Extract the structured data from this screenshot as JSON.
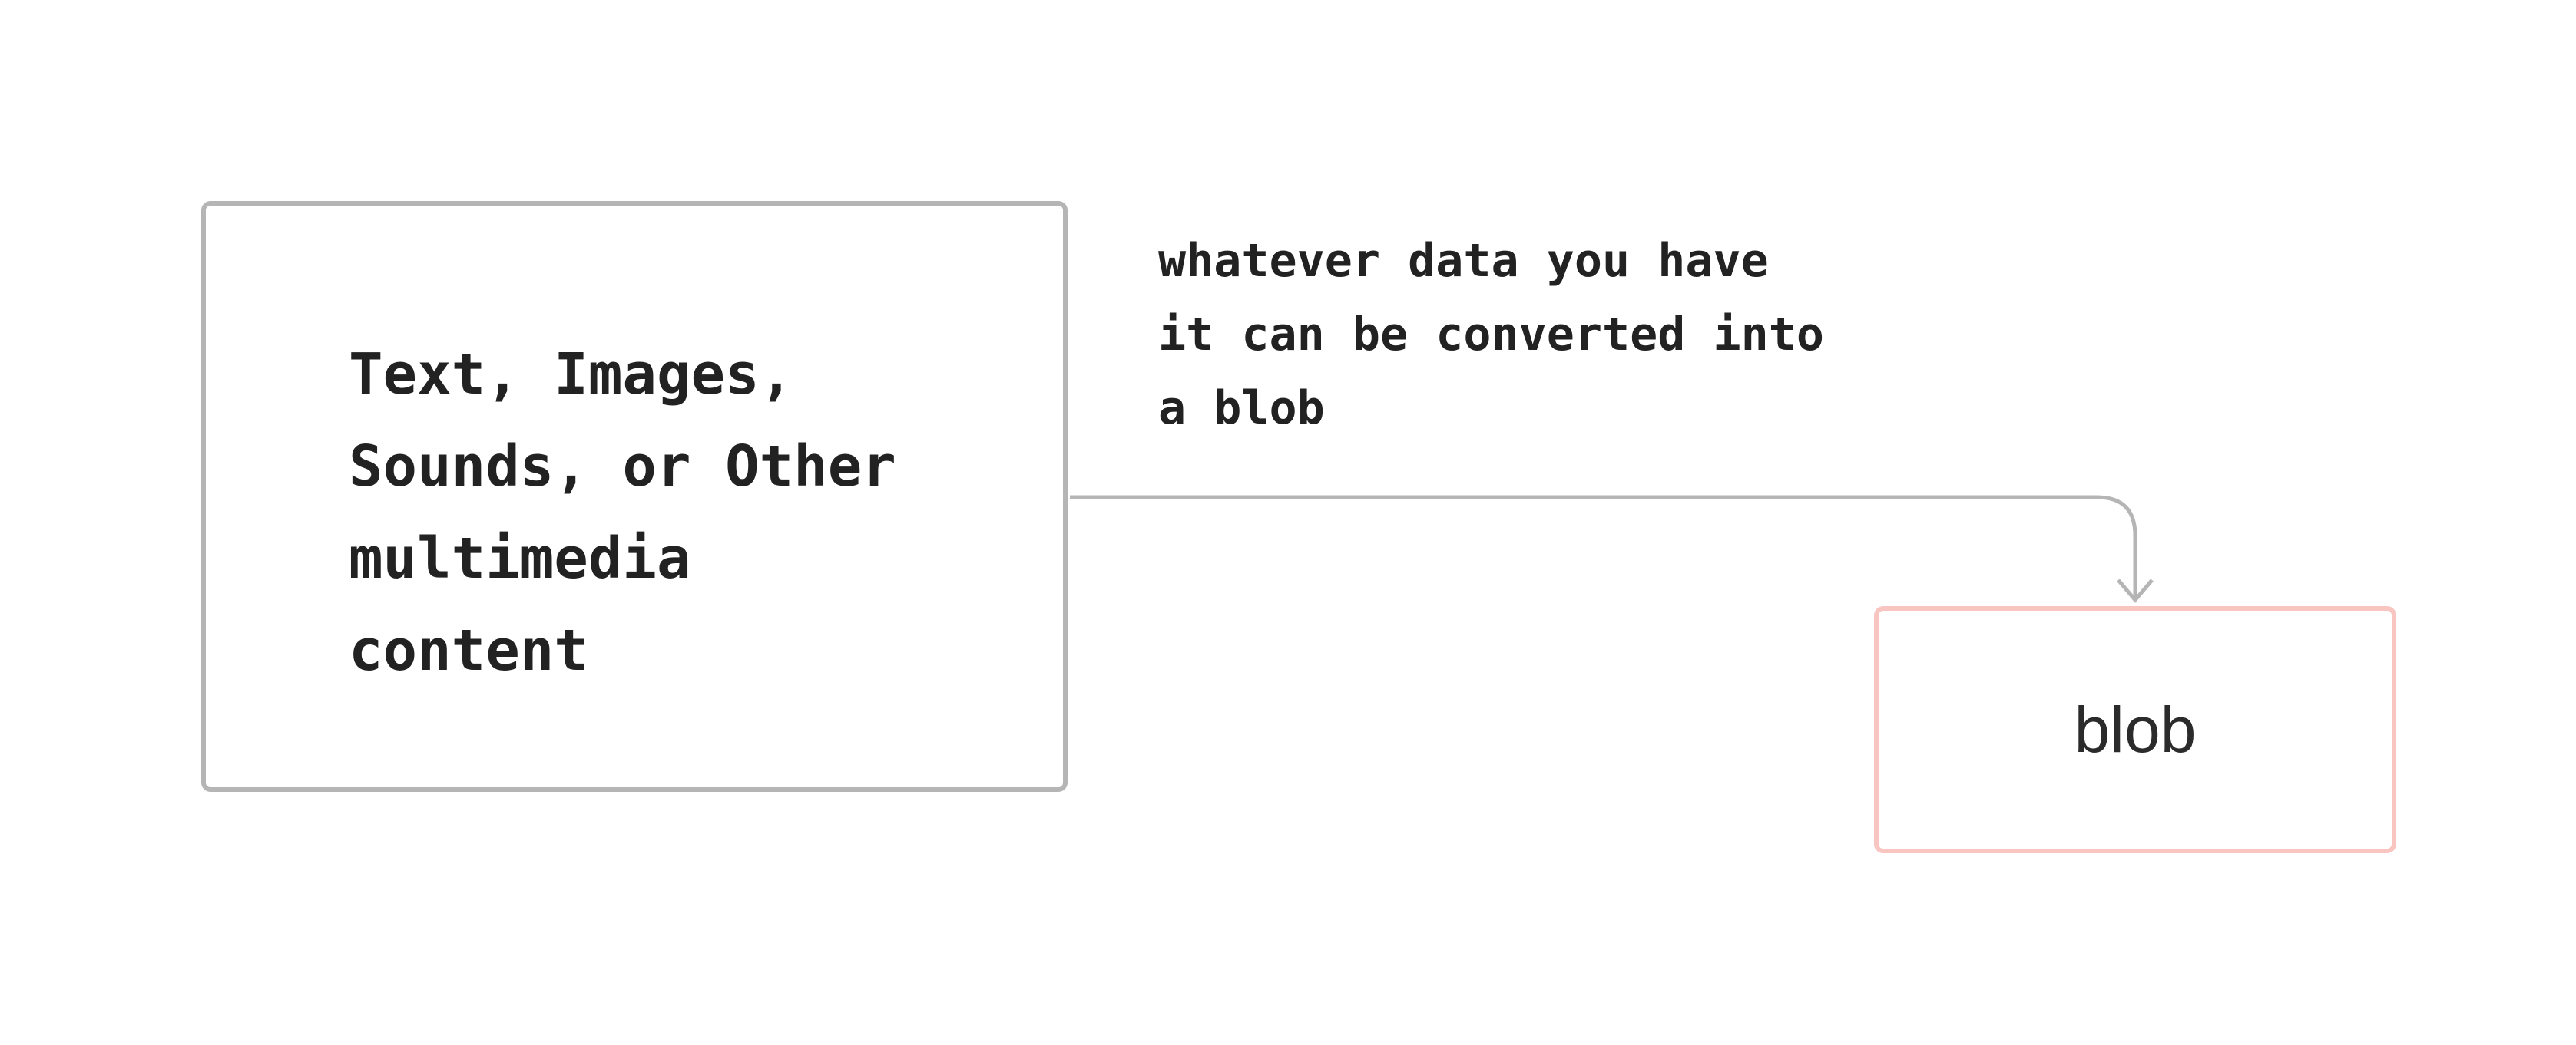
{
  "diagram": {
    "source_box": {
      "lines": [
        "Text, Images,",
        "Sounds, or Other",
        "multimedia",
        "content"
      ]
    },
    "annotation": {
      "lines": [
        "whatever data you have",
        "it can be converted into",
        "a blob"
      ]
    },
    "target_box": {
      "label": "blob"
    },
    "colors": {
      "source_border": "#b5b5b5",
      "target_border": "#f9c5c0",
      "connector": "#b5b5b5",
      "text": "#222222"
    }
  }
}
